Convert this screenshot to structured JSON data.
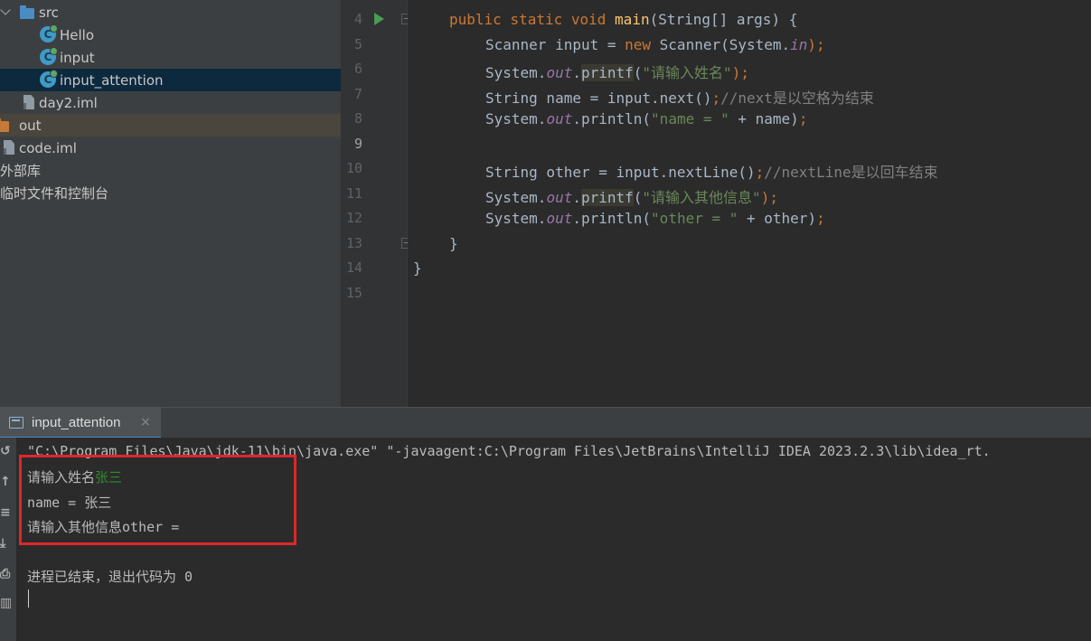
{
  "project_tree": {
    "items": [
      {
        "label": "src",
        "kind": "folder"
      },
      {
        "label": "Hello",
        "kind": "class"
      },
      {
        "label": "input",
        "kind": "class"
      },
      {
        "label": "input_attention",
        "kind": "class",
        "selected": true
      },
      {
        "label": "day2.iml",
        "kind": "file"
      },
      {
        "label": "out",
        "kind": "folder"
      },
      {
        "label": "code.iml",
        "kind": "file"
      },
      {
        "label": "外部库",
        "kind": "library"
      },
      {
        "label": "临时文件和控制台",
        "kind": "scratch"
      }
    ],
    "icons": {
      "class_letter": "C",
      "folder_src_color": "#4a8dc4",
      "folder_out_color": "#c57a3a",
      "selected_row_color": "#0d293e"
    }
  },
  "editor": {
    "line_numbers": [
      "4",
      "5",
      "6",
      "7",
      "8",
      "9",
      "10",
      "11",
      "12",
      "13",
      "14",
      "15"
    ],
    "current_line": "9",
    "lines": {
      "l4": {
        "public": "public",
        "static": "static",
        "void": "void",
        "main": "main",
        "rest": "(String[] args) {"
      },
      "l5": {
        "a": "Scanner input = ",
        "new": "new",
        "b": " Scanner(System.",
        "in": "in",
        "c": ");"
      },
      "l6": {
        "a": "System.",
        "out": "out",
        "dot": ".",
        "printf": "printf",
        "paren": "(",
        "str": "\"请输入姓名\"",
        "end": ");"
      },
      "l7": {
        "a": "String name = input.next()",
        "semi": ";",
        "cmt": "//next是以空格为结束"
      },
      "l8": {
        "a": "System.",
        "out": "out",
        "b": ".println(",
        "str": "\"name = \"",
        "c": " + name)",
        "semi": ";"
      },
      "l10": {
        "a": "String other = input.nextLine()",
        "semi": ";",
        "cmt": "//nextLine是以回车结束"
      },
      "l11": {
        "a": "System.",
        "out": "out",
        "dot": ".",
        "printf": "printf",
        "paren": "(",
        "str": "\"请输入其他信息\"",
        "end": ");"
      },
      "l12": {
        "a": "System.",
        "out": "out",
        "b": ".println(",
        "str": "\"other = \"",
        "c": " + other)",
        "semi": ";"
      },
      "l13": {
        "a": "}"
      },
      "l14": {
        "a": "}"
      }
    }
  },
  "run_window": {
    "tab_label": "input_attention",
    "tab_close": "×",
    "console": {
      "command": "\"C:\\Program Files\\Java\\jdk-11\\bin\\java.exe\" \"-javaagent:C:\\Program Files\\JetBrains\\IntelliJ IDEA 2023.2.3\\lib\\idea_rt.",
      "prompt1": "请输入姓名",
      "input1": "张三",
      "output1": "name = 张三",
      "prompt2": "请输入其他信息",
      "output2": "other =",
      "exit": "进程已结束，退出代码为 0"
    },
    "highlight_box_color": "#e0262b"
  }
}
